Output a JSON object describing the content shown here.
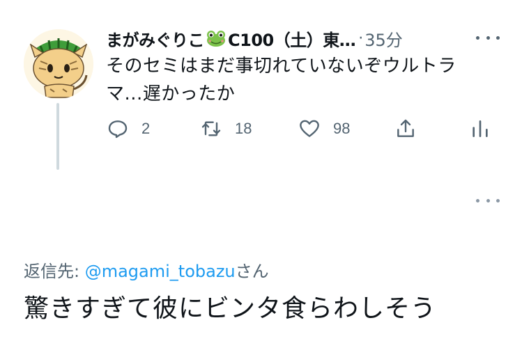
{
  "tweet": {
    "author": {
      "name_before_emoji": "まがみぐりこ",
      "emoji_icon": "frog-icon",
      "name_after_emoji": "C100（土）東…",
      "separator": "·",
      "time": "35分"
    },
    "text_line1": "そのセミはまだ事切れていないぞウルトラ",
    "text_line2": "マ...遅かったか",
    "actions": {
      "reply_count": "2",
      "retweet_count": "18",
      "like_count": "98"
    }
  },
  "reply": {
    "reply_to_prefix": "返信先: ",
    "reply_to_handle": "@magami_tobazu",
    "reply_to_suffix": "さん",
    "text": "驚きすぎて彼にビンタ食らわしそう"
  },
  "colors": {
    "text": "#0f1419",
    "secondary": "#536471",
    "link": "#1d9bf0",
    "thread_line": "#cfd9de"
  }
}
